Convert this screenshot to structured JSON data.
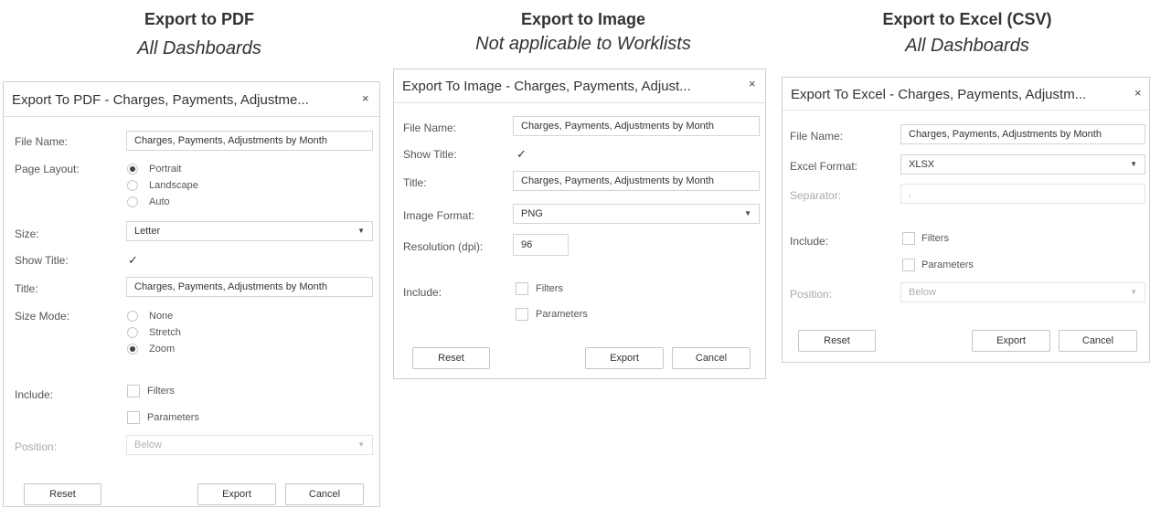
{
  "columns": [
    {
      "heading": "Export to PDF",
      "subheading": "All Dashboards"
    },
    {
      "heading": "Export to Image",
      "subheading": "Not applicable to Worklists"
    },
    {
      "heading": "Export to Excel (CSV)",
      "subheading": "All Dashboards"
    }
  ],
  "close_glyph": "×",
  "check_glyph": "✓",
  "select_arrow": "▼",
  "pdf": {
    "title": "Export To PDF - Charges, Payments, Adjustme...",
    "file_name_label": "File Name:",
    "file_name_value": "Charges, Payments, Adjustments by Month",
    "page_layout_label": "Page Layout:",
    "page_layout_options": [
      "Portrait",
      "Landscape",
      "Auto"
    ],
    "page_layout_selected": "Portrait",
    "size_label": "Size:",
    "size_value": "Letter",
    "show_title_label": "Show Title:",
    "show_title_checked": true,
    "title_label": "Title:",
    "title_value": "Charges, Payments, Adjustments by Month",
    "size_mode_label": "Size Mode:",
    "size_mode_options": [
      "None",
      "Stretch",
      "Zoom"
    ],
    "size_mode_selected": "Zoom",
    "include_label": "Include:",
    "include_filters": "Filters",
    "include_parameters": "Parameters",
    "position_label": "Position:",
    "position_value": "Below",
    "reset_label": "Reset",
    "export_label": "Export",
    "cancel_label": "Cancel"
  },
  "image": {
    "title": "Export To Image - Charges, Payments, Adjust...",
    "file_name_label": "File Name:",
    "file_name_value": "Charges, Payments, Adjustments by Month",
    "show_title_label": "Show Title:",
    "show_title_checked": true,
    "title_label": "Title:",
    "title_value": "Charges, Payments, Adjustments by Month",
    "image_format_label": "Image Format:",
    "image_format_value": "PNG",
    "resolution_label": "Resolution (dpi):",
    "resolution_value": "96",
    "include_label": "Include:",
    "include_filters": "Filters",
    "include_parameters": "Parameters",
    "reset_label": "Reset",
    "export_label": "Export",
    "cancel_label": "Cancel"
  },
  "excel": {
    "title": "Export To Excel - Charges, Payments, Adjustm...",
    "file_name_label": "File Name:",
    "file_name_value": "Charges, Payments, Adjustments by Month",
    "excel_format_label": "Excel Format:",
    "excel_format_value": "XLSX",
    "separator_label": "Separator:",
    "separator_value": ",",
    "include_label": "Include:",
    "include_filters": "Filters",
    "include_parameters": "Parameters",
    "position_label": "Position:",
    "position_value": "Below",
    "reset_label": "Reset",
    "export_label": "Export",
    "cancel_label": "Cancel"
  }
}
